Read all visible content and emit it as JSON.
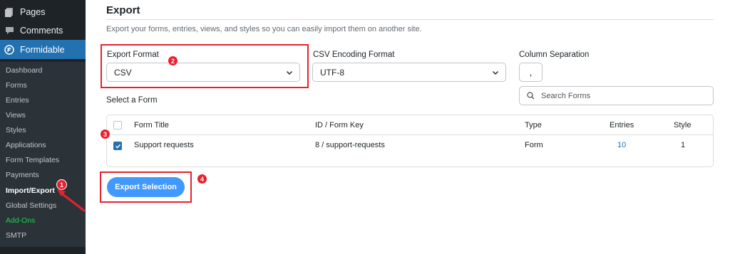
{
  "sidebar": {
    "top_items": [
      {
        "label": "Pages",
        "icon": "pages-icon"
      },
      {
        "label": "Comments",
        "icon": "comments-icon"
      },
      {
        "label": "Formidable",
        "icon": "formidable-icon"
      }
    ],
    "submenu": [
      {
        "label": "Dashboard"
      },
      {
        "label": "Forms"
      },
      {
        "label": "Entries"
      },
      {
        "label": "Views"
      },
      {
        "label": "Styles"
      },
      {
        "label": "Applications"
      },
      {
        "label": "Form Templates"
      },
      {
        "label": "Payments"
      },
      {
        "label": "Import/Export"
      },
      {
        "label": "Global Settings"
      },
      {
        "label": "Add-Ons"
      },
      {
        "label": "SMTP"
      }
    ],
    "current_item": "Import/Export",
    "addons_color": "#1ed14b",
    "accent": "#2271b1"
  },
  "export": {
    "heading": "Export",
    "description": "Export your forms, entries, views, and styles so you can easily import them on another site.",
    "format_label": "Export Format",
    "format_value": "CSV",
    "encoding_label": "CSV Encoding Format",
    "encoding_value": "UTF-8",
    "separation_label": "Column Separation",
    "separation_value": ",",
    "search_placeholder": "Search Forms",
    "select_label": "Select a Form",
    "table": {
      "headers": [
        "Form Title",
        "ID / Form Key",
        "Type",
        "Entries",
        "Style"
      ],
      "rows": [
        {
          "checked": true,
          "title": "Support requests",
          "key": "8 / support-requests",
          "type": "Form",
          "entries": "10",
          "style": "1"
        }
      ]
    },
    "button_label": "Export Selection"
  },
  "annotations": {
    "color": "#e8212f",
    "badges": [
      "1",
      "2",
      "3",
      "4"
    ]
  }
}
